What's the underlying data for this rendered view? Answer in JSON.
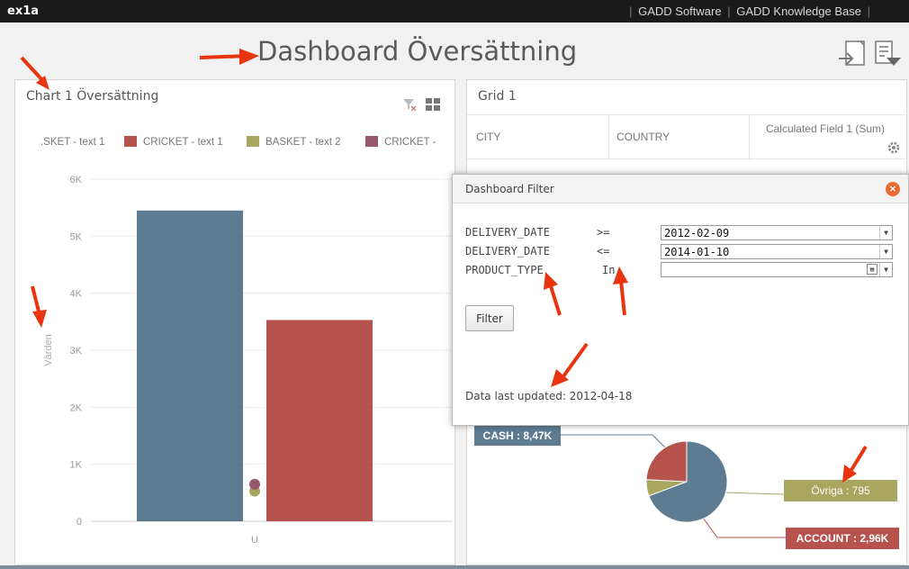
{
  "topbar": {
    "app_name": "ex1a",
    "links": [
      "GADD Software",
      "GADD Knowledge Base"
    ]
  },
  "dashboard": {
    "title": "Dashboard Översättning",
    "icons": [
      "export-icon",
      "filter-panel-icon"
    ]
  },
  "chart_panel": {
    "title": "Chart 1 Översättning",
    "icons": [
      "clear-filter-icon",
      "grid-layout-icon"
    ],
    "chart_data": {
      "type": "bar",
      "legend": [
        {
          "label": ".SKET - text 1",
          "color": "#5d7b91"
        },
        {
          "label": "CRICKET - text 1",
          "color": "#b5534c"
        },
        {
          "label": "BASKET - text 2",
          "color": "#a8a65f"
        },
        {
          "label": "CRICKET - ",
          "color": "#96586d"
        }
      ],
      "categories": [
        "U"
      ],
      "series": [
        {
          "name": ".SKET - text 1",
          "values": [
            5450
          ],
          "color": "#5d7b91"
        },
        {
          "name": "CRICKET - text 1",
          "values": [
            3530
          ],
          "color": "#b5534c"
        },
        {
          "name": "BASKET - text 2",
          "values": [
            560
          ],
          "color": "#a8a65f"
        },
        {
          "name": "CRICKET - ",
          "values": [
            650
          ],
          "color": "#96586d"
        }
      ],
      "ylabel": "Värden",
      "ylim": [
        0,
        6000
      ],
      "yticks": [
        {
          "value": 0,
          "label": "0"
        },
        {
          "value": 1000,
          "label": "1K"
        },
        {
          "value": 2000,
          "label": "2K"
        },
        {
          "value": 3000,
          "label": "3K"
        },
        {
          "value": 4000,
          "label": "4K"
        },
        {
          "value": 5000,
          "label": "5K"
        },
        {
          "value": 6000,
          "label": "6K"
        }
      ],
      "grid": true
    }
  },
  "grid_panel": {
    "title": "Grid 1",
    "columns": [
      "CITY",
      "COUNTRY",
      "Calculated Field 1 (Sum)"
    ],
    "column_icon": "gear-icon"
  },
  "pie": {
    "chart_data": {
      "type": "pie",
      "slices": [
        {
          "label": "CASH",
          "value_label": "8,47K",
          "value": 8470,
          "color": "#5d7b91"
        },
        {
          "label": "ACCOUNT",
          "value_label": "2,96K",
          "value": 2960,
          "color": "#b5534c"
        },
        {
          "label": "Övriga",
          "value_label": "795",
          "value": 795,
          "color": "#a8a65f"
        }
      ]
    },
    "labels": {
      "cash": "CASH : 8,47K",
      "account": "ACCOUNT : 2,96K",
      "ovriga": "Övriga : 795"
    }
  },
  "filter_dialog": {
    "title": "Dashboard Filter",
    "rows": [
      {
        "field": "DELIVERY_DATE",
        "operator": ">=",
        "value": "2012-02-09"
      },
      {
        "field": "DELIVERY_DATE",
        "operator": "<=",
        "value": "2014-01-10"
      },
      {
        "field": "PRODUCT_TYPE",
        "operator": "In",
        "value": ""
      }
    ],
    "filter_button": "Filter",
    "updated_text": "Data last updated: 2012-04-18"
  },
  "colors": {
    "topbar": "#1a1a1a",
    "annotation_arrow": "#e8350f",
    "close": "#e96a2a"
  }
}
